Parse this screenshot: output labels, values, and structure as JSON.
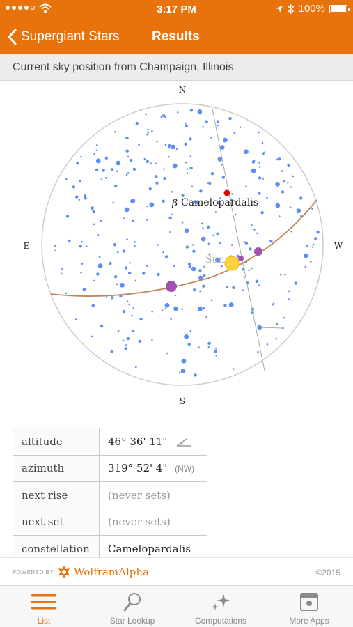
{
  "status_bar": {
    "time": "3:17 PM",
    "battery": "100%",
    "icons": [
      "signal-dots-icon",
      "wifi-icon",
      "location-arrow-icon",
      "bluetooth-icon",
      "battery-icon"
    ]
  },
  "nav": {
    "back_label": "Supergiant Stars",
    "title": "Results"
  },
  "subheader": "Current sky position from Champaign, Illinois",
  "sky_chart": {
    "compass": {
      "north": "N",
      "south": "S",
      "east": "E",
      "west": "W"
    },
    "star_label_greek": "β",
    "star_label_name": "Camelopardalis",
    "sun_label": "Sun",
    "colors": {
      "stars": "#5b8ff0",
      "constellation_lines": "#9a9a9a",
      "ecliptic": "#c0865a",
      "target_star": "#e60000",
      "sun": "#ffd23f",
      "planets": "#a050b0"
    }
  },
  "table": {
    "rows": [
      {
        "label": "altitude",
        "value": "46° 36' 11\"",
        "icon": "angle-icon"
      },
      {
        "label": "azimuth",
        "value": "319° 52' 4\"",
        "note": "(NW)"
      },
      {
        "label": "next rise",
        "value": "(never sets)"
      },
      {
        "label": "next set",
        "value": "(never sets)"
      },
      {
        "label": "constellation",
        "value": "Camelopardalis"
      }
    ]
  },
  "footer": {
    "powered_by": "POWERED BY",
    "brand": "WolframAlpha",
    "copyright": "©2015"
  },
  "tabs": [
    {
      "label": "List",
      "icon": "list-icon",
      "active": true
    },
    {
      "label": "Star Lookup",
      "icon": "magnifier-icon",
      "active": false
    },
    {
      "label": "Computations",
      "icon": "sparkles-icon",
      "active": false
    },
    {
      "label": "More Apps",
      "icon": "apps-window-icon",
      "active": false
    }
  ]
}
